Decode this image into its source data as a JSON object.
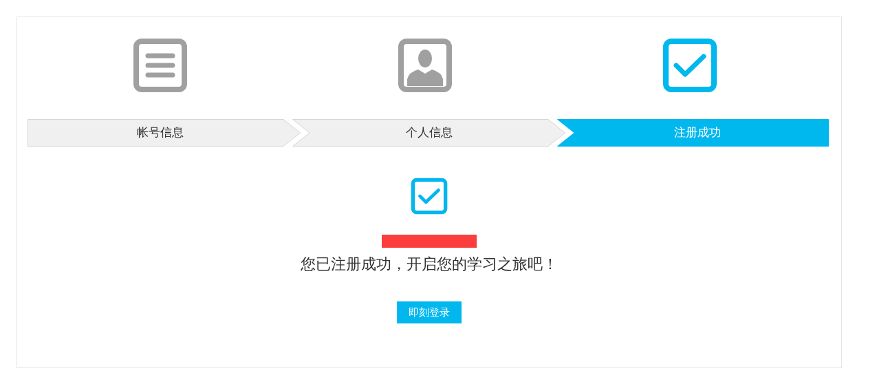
{
  "steps": [
    {
      "kind": "list",
      "label": "帐号信息",
      "selected": false
    },
    {
      "kind": "person",
      "label": "个人信息",
      "selected": false
    },
    {
      "kind": "check",
      "label": "注册成功",
      "selected": true
    }
  ],
  "result": {
    "username_redacted": true,
    "message": "您已注册成功，开启您的学习之旅吧！",
    "button": "即刻登录"
  }
}
